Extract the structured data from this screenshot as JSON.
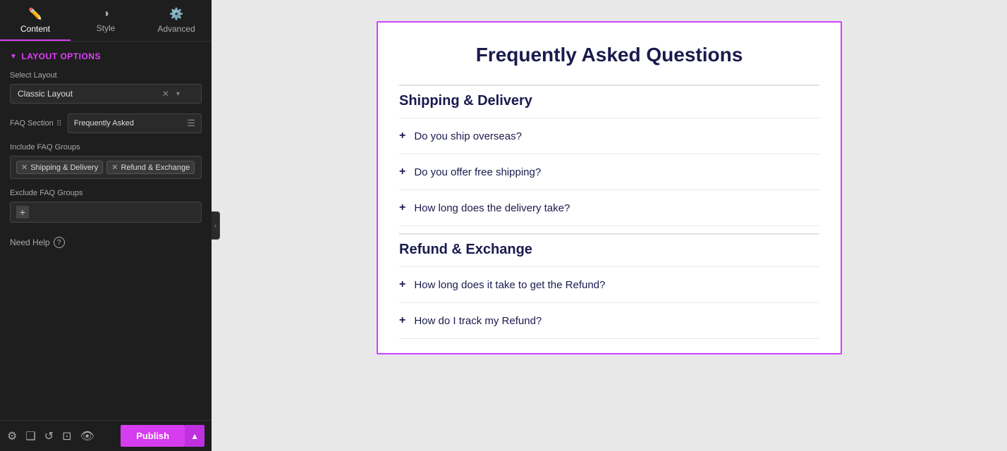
{
  "tabs": [
    {
      "id": "content",
      "label": "Content",
      "icon": "✏️",
      "active": true
    },
    {
      "id": "style",
      "label": "Style",
      "icon": "◑",
      "active": false
    },
    {
      "id": "advanced",
      "label": "Advanced",
      "icon": "⚙️",
      "active": false
    }
  ],
  "panel": {
    "section_title": "Layout Options",
    "select_layout_label": "Select Layout",
    "layout_value": "Classic Layout",
    "faq_section_label": "FAQ Section",
    "faq_section_value": "Frequently Asked",
    "include_groups_label": "Include FAQ Groups",
    "tags": [
      {
        "label": "Shipping & Delivery"
      },
      {
        "label": "Refund & Exchange"
      }
    ],
    "exclude_groups_label": "Exclude FAQ Groups",
    "need_help_label": "Need Help"
  },
  "bottom_bar": {
    "publish_label": "Publish"
  },
  "faq": {
    "main_title": "Frequently Asked Questions",
    "groups": [
      {
        "title": "Shipping & Delivery",
        "items": [
          "Do you ship overseas?",
          "Do you offer free shipping?",
          "How long does the delivery take?"
        ]
      },
      {
        "title": "Refund & Exchange",
        "items": [
          "How long does it take to get the Refund?",
          "How do I track my Refund?"
        ]
      }
    ]
  }
}
